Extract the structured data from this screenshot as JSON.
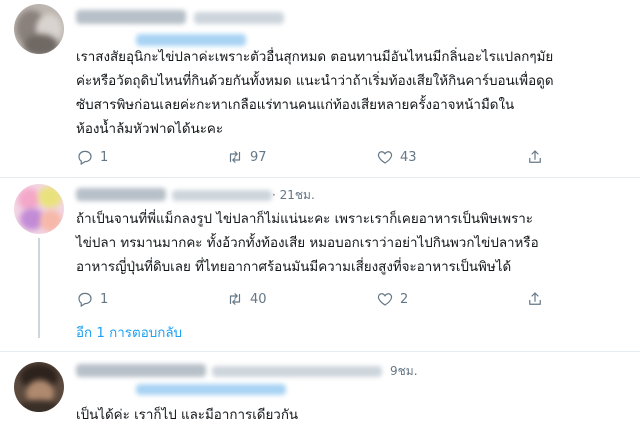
{
  "tweets": [
    {
      "time": "",
      "lines": [
        "เราสงสัยอุนิกะไข่ปลาค่ะเพราะตัวอื่นสุกหมด ตอนทานมีอันไหนมีกลิ่นอะไรแปลกๆมัย",
        "ค่ะหรือวัตถุดิบไหนที่กินด้วยกันทั้งหมด แนะนำว่าถ้าเริ่มท้องเสียให้กินคาร์บอนเพื่อดูด",
        "ซับสารพิษก่อนเลยค่ะกะหาเกลือแร่ทานคนแก่ท้องเสียหลายครั้งอาจหน้ามืดใน",
        "ห้องน้ำล้มหัวฟาดได้นะคะ"
      ],
      "replies": "1",
      "retweets": "97",
      "likes": "43"
    },
    {
      "time": "· 21ชม.",
      "lines": [
        "ถ้าเป็นจานที่พี่แม็กลงรูป ไข่ปลาก็ไม่แน่นะคะ เพราะเราก็เคยอาหารเป็นพิษเพราะ",
        "ไข่ปลา ทรมานมากคะ ทั้งอ้วกทั้งท้องเสีย หมอบอกเราว่าอย่าไปกินพวกไข่ปลาหรือ",
        "อาหารญี่ปุ่นที่ดิบเลย ที่ไทยอากาศร้อนมันมีความเสี่ยงสูงที่จะอาหารเป็นพิษได้"
      ],
      "replies": "1",
      "retweets": "40",
      "likes": "2"
    },
    {
      "time": "9ชม.",
      "lines": [
        "เป็นได้ค่ะ เราก็ไป และมีอาการเดียวกัน"
      ]
    }
  ],
  "show_replies_label": "อีก 1 การตอบกลับ",
  "icons": {
    "reply": "comment-bubble",
    "retweet": "retweet-arrows",
    "like": "heart",
    "share": "share-upload"
  },
  "colors": {
    "text": "#14171a",
    "muted": "#657786",
    "link": "#1da1f2",
    "divider": "#e6ecf0"
  }
}
